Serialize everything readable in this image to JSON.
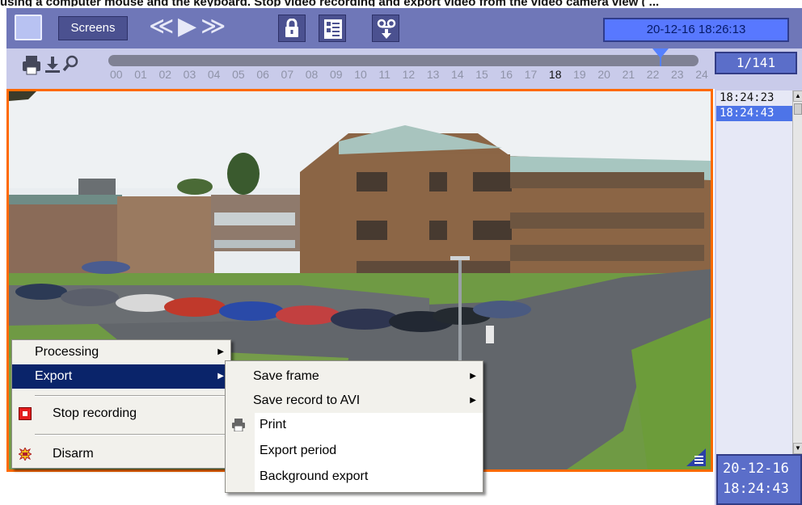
{
  "doc_top_text": "using a computer mouse and the keyboard. Stop video recording and export video from the video camera view ( ...",
  "toolbar": {
    "screens_label": "Screens",
    "datetime": "20-12-16 18:26:13"
  },
  "timeline": {
    "hours": [
      "00",
      "01",
      "02",
      "03",
      "04",
      "05",
      "06",
      "07",
      "08",
      "09",
      "10",
      "11",
      "12",
      "13",
      "14",
      "15",
      "16",
      "17",
      "18",
      "19",
      "20",
      "21",
      "22",
      "23",
      "24"
    ],
    "current_hour": "18",
    "counter": "1/141"
  },
  "records": {
    "items": [
      "18:24:23",
      "18:24:43"
    ],
    "selected": "18:24:43",
    "current_date": "20-12-16",
    "current_time": "18:24:43"
  },
  "context_menu": {
    "items": [
      "Processing",
      "Export",
      "Stop recording",
      "Disarm"
    ],
    "highlighted": "Export"
  },
  "export_submenu": {
    "items": [
      "Save frame",
      "Save record to AVI",
      "Print",
      "Export period",
      "Background export"
    ]
  },
  "colors": {
    "toolbar_bg": "#6f77b8",
    "frame_border": "#ff6a00",
    "menu_highlight": "#0a246a",
    "datetime_bg": "#5878ff"
  }
}
